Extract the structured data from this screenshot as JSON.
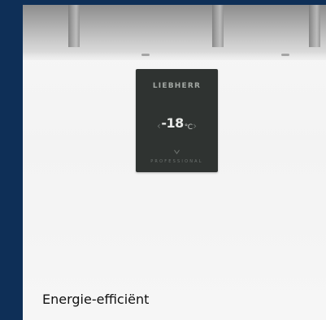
{
  "control_panel": {
    "brand": "LIEBHERR",
    "temperature": "-18",
    "unit": "°C",
    "brand_line": "PROFESSIONAL"
  },
  "caption": {
    "text": "Energie-efficiënt"
  },
  "colors": {
    "side_band": "#0e2f57",
    "panel": "#2f3331",
    "background": "#f6f6f6",
    "text": "#111111"
  }
}
